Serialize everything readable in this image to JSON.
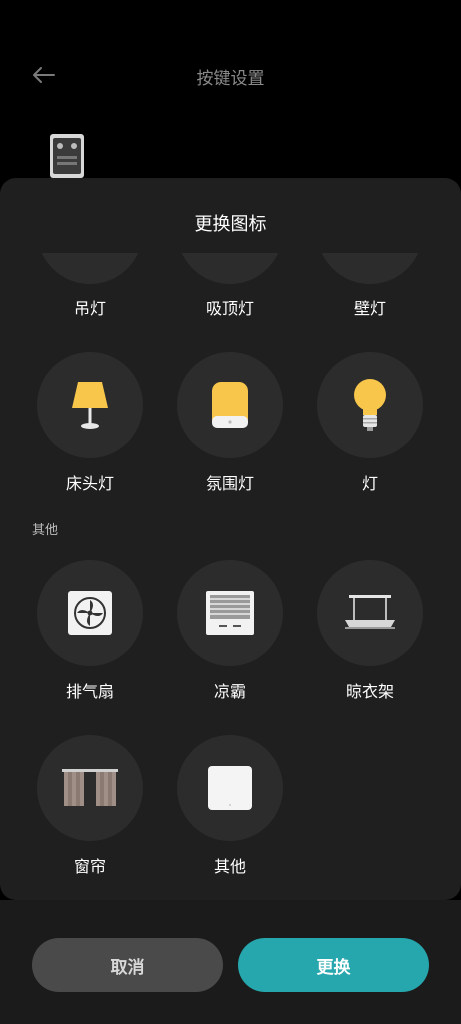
{
  "header": {
    "title": "按键设置"
  },
  "sheet": {
    "title": "更换图标"
  },
  "icons_top_partial": [
    {
      "label": "吊灯",
      "icon": "pendant-lamp-icon"
    },
    {
      "label": "吸顶灯",
      "icon": "ceiling-lamp-icon"
    },
    {
      "label": "壁灯",
      "icon": "wall-lamp-icon"
    }
  ],
  "icons_row2": [
    {
      "label": "床头灯",
      "icon": "bedside-lamp-icon"
    },
    {
      "label": "氛围灯",
      "icon": "ambient-light-icon"
    },
    {
      "label": "灯",
      "icon": "light-bulb-icon"
    }
  ],
  "section_other": {
    "label": "其他"
  },
  "icons_other_row1": [
    {
      "label": "排气扇",
      "icon": "exhaust-fan-icon"
    },
    {
      "label": "凉霸",
      "icon": "cooling-fan-icon"
    },
    {
      "label": "晾衣架",
      "icon": "clothes-rack-icon"
    }
  ],
  "icons_other_row2": [
    {
      "label": "窗帘",
      "icon": "curtain-icon"
    },
    {
      "label": "其他",
      "icon": "other-switch-icon"
    }
  ],
  "footer": {
    "cancel_label": "取消",
    "confirm_label": "更换"
  },
  "colors": {
    "accent": "#26a6ad",
    "sheet_bg": "#1f1f1f",
    "circle_bg": "#2c2c2c",
    "lamp_yellow": "#f7c64a"
  }
}
